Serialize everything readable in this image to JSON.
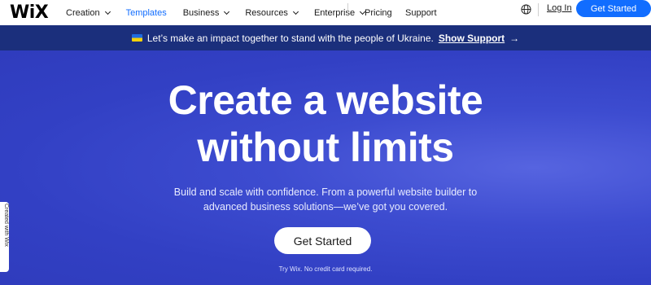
{
  "header": {
    "logo": "WiX",
    "nav": [
      {
        "label": "Creation",
        "dropdown": true,
        "active": false
      },
      {
        "label": "Templates",
        "dropdown": false,
        "active": true
      },
      {
        "label": "Business",
        "dropdown": true,
        "active": false
      },
      {
        "label": "Resources",
        "dropdown": true,
        "active": false
      },
      {
        "label": "Enterprise",
        "dropdown": true,
        "active": false
      }
    ],
    "secondary": [
      {
        "label": "Pricing"
      },
      {
        "label": "Support"
      }
    ],
    "login": "Log In",
    "get_started": "Get Started"
  },
  "banner": {
    "text": "Let’s make an impact together to stand with the people of Ukraine.",
    "link": "Show Support",
    "arrow": "→"
  },
  "hero": {
    "headline_line1": "Create a website",
    "headline_line2": "without limits",
    "subtext_line1": "Build and scale with confidence. From a powerful website builder to",
    "subtext_line2": "advanced business solutions—we’ve got you covered.",
    "cta": "Get Started",
    "note": "Try Wix. No credit card required."
  },
  "side_tab": {
    "label": "Created with Wix"
  },
  "colors": {
    "accent": "#116dff",
    "banner_bg": "#1b2f7c",
    "hero_bg": "#3240c4"
  },
  "icons": {
    "globe": "globe-icon",
    "flag": "ukraine-flag-icon",
    "chevron": "chevron-down-icon"
  }
}
